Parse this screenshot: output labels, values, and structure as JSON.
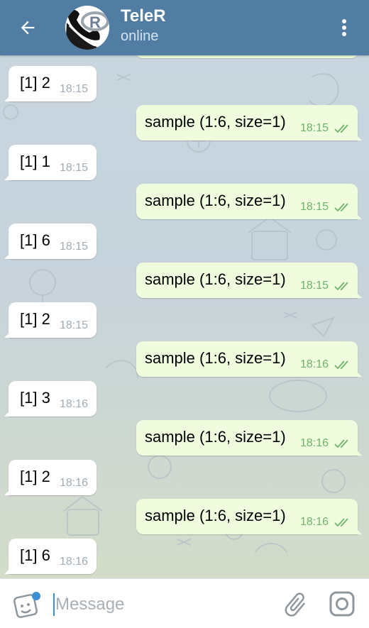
{
  "header": {
    "title": "TeleR",
    "status": "online",
    "avatar_letter": "R"
  },
  "messages": [
    {
      "dir": "in",
      "text": "[1] 2",
      "time": "18:15"
    },
    {
      "dir": "out",
      "text": "sample (1:6, size=1)",
      "time": "18:15",
      "read": true
    },
    {
      "dir": "in",
      "text": "[1] 1",
      "time": "18:15"
    },
    {
      "dir": "out",
      "text": "sample (1:6, size=1)",
      "time": "18:15",
      "read": true
    },
    {
      "dir": "in",
      "text": "[1] 6",
      "time": "18:15"
    },
    {
      "dir": "out",
      "text": "sample (1:6, size=1)",
      "time": "18:15",
      "read": true
    },
    {
      "dir": "in",
      "text": "[1] 2",
      "time": "18:15"
    },
    {
      "dir": "out",
      "text": "sample (1:6, size=1)",
      "time": "18:16",
      "read": true
    },
    {
      "dir": "in",
      "text": "[1] 3",
      "time": "18:16"
    },
    {
      "dir": "out",
      "text": "sample (1:6, size=1)",
      "time": "18:16",
      "read": true
    },
    {
      "dir": "in",
      "text": "[1] 2",
      "time": "18:16"
    },
    {
      "dir": "out",
      "text": "sample (1:6, size=1)",
      "time": "18:16",
      "read": true
    },
    {
      "dir": "in",
      "text": "[1] 6",
      "time": "18:16"
    }
  ],
  "input": {
    "placeholder": "Message",
    "value": ""
  },
  "icons": {
    "back": "arrow-left-icon",
    "menu": "more-vertical-icon",
    "emoji": "sticker-icon",
    "attach": "paperclip-icon",
    "camera": "instagram-camera-icon",
    "read": "double-check-icon"
  },
  "colors": {
    "header": "#517da2",
    "outgoing_bubble": "#effdde",
    "incoming_bubble": "#ffffff",
    "time_out": "#6fb26a",
    "cursor": "#3d8fd6"
  }
}
